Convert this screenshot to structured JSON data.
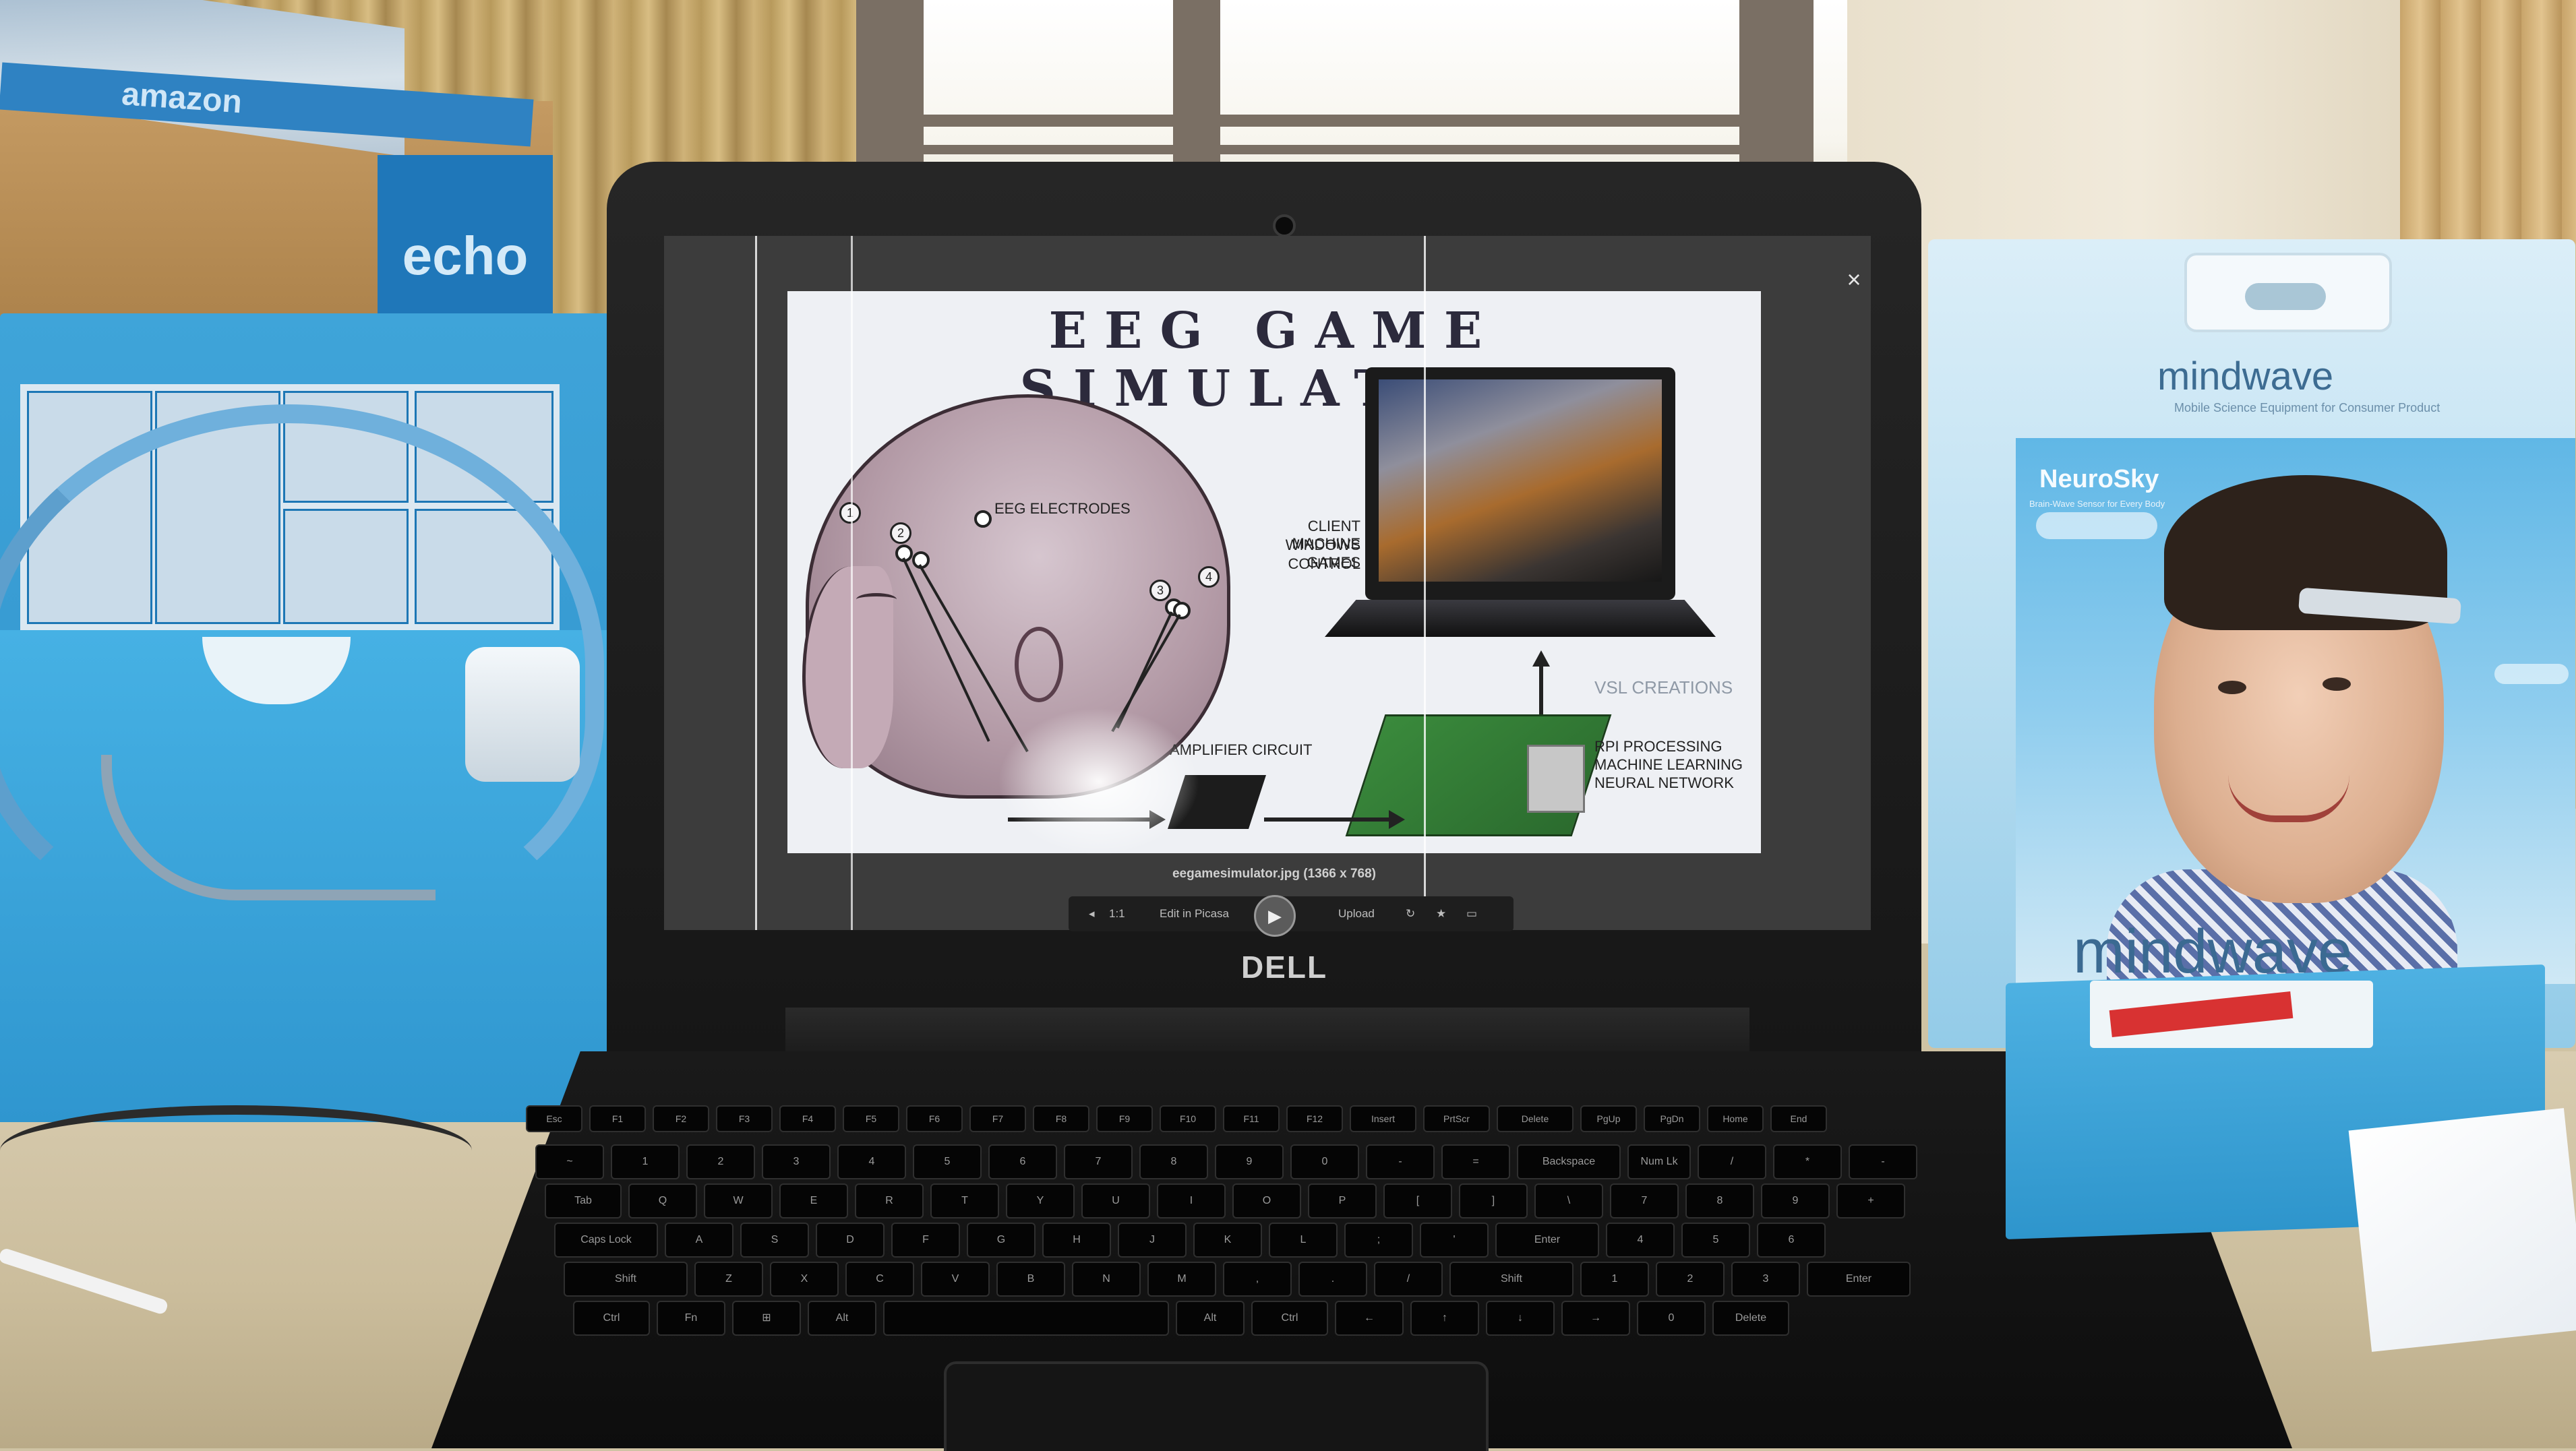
{
  "slide": {
    "title": "EEG GAME SIMULATOR",
    "labels": {
      "electrodes": "EEG ELECTRODES",
      "client_1": "CLIENT MACHINE",
      "client_2": "WINDOWS GAMES",
      "client_3": "CONTROL",
      "amplifier": "AMPLIFIER CIRCUIT",
      "rpi_1": "RPI PROCESSING",
      "rpi_2": "MACHINE LEARNING",
      "rpi_3": "NEURAL NETWORK",
      "watermark": "VSL CREATIONS"
    },
    "electrode_numbers": [
      "1",
      "2",
      "3",
      "4"
    ]
  },
  "viewer": {
    "filename": "eegamesimulator.jpg (1366 x 768)",
    "zoom_label": "1:1",
    "edit_label": "Edit in Picasa",
    "upload_label": "Upload",
    "play_icon": "▶",
    "close_icon": "×"
  },
  "laptop": {
    "brand": "DELL"
  },
  "keyboard": {
    "rows": [
      [
        "Esc",
        "F1",
        "F2",
        "F3",
        "F4",
        "F5",
        "F6",
        "F7",
        "F8",
        "F9",
        "F10",
        "F11",
        "F12",
        "Insert",
        "PrtScr",
        "Delete",
        "PgUp",
        "PgDn",
        "Home",
        "End"
      ],
      [
        "~",
        "1",
        "2",
        "3",
        "4",
        "5",
        "6",
        "7",
        "8",
        "9",
        "0",
        "-",
        "=",
        "Backspace",
        "Num Lk",
        "/",
        "*",
        "-"
      ],
      [
        "Tab",
        "Q",
        "W",
        "E",
        "R",
        "T",
        "Y",
        "U",
        "I",
        "O",
        "P",
        "[",
        "]",
        "\\",
        "7",
        "8",
        "9",
        "+"
      ],
      [
        "Caps Lock",
        "A",
        "S",
        "D",
        "F",
        "G",
        "H",
        "J",
        "K",
        "L",
        ";",
        "'",
        "Enter",
        "4",
        "5",
        "6"
      ],
      [
        "Shift",
        "Z",
        "X",
        "C",
        "V",
        "B",
        "N",
        "M",
        ",",
        ".",
        "/",
        "Shift",
        "1",
        "2",
        "3",
        "Enter"
      ],
      [
        "Ctrl",
        "Fn",
        "⊞",
        "Alt",
        "",
        "Alt",
        "Ctrl",
        "←",
        "↑",
        "↓",
        "→",
        "0",
        "Delete"
      ]
    ]
  },
  "boxes": {
    "amazon_tape": "amazon",
    "echo": "echo",
    "mindwave_top": "mindwave",
    "mindwave_subtitle": "Mobile Science Equipment for Consumer Product",
    "neurosky": "NeuroSky",
    "neurosky_sub": "Brain-Wave Sensor for Every Body",
    "mindwave_bottom": "mindwave"
  }
}
